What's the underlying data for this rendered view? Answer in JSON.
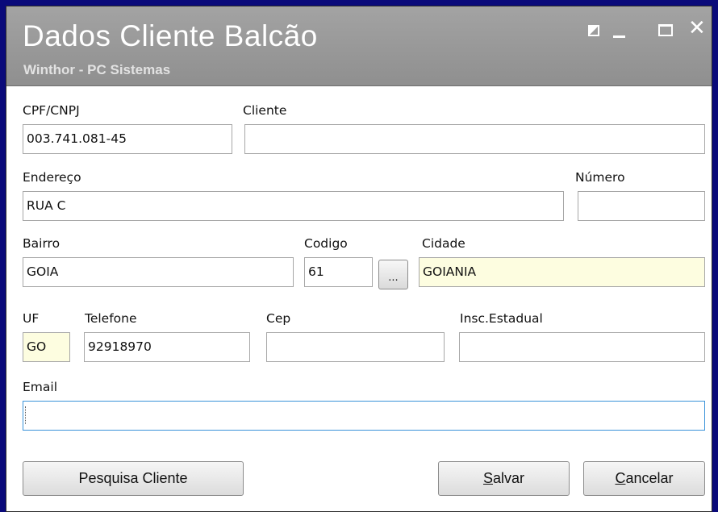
{
  "window": {
    "title": "Dados Cliente Balcão",
    "subtitle": "Winthor - PC Sistemas",
    "controls": {
      "close_glyph": "✕"
    }
  },
  "form": {
    "cpf": {
      "label": "CPF/CNPJ",
      "value": "003.741.081-45"
    },
    "cliente": {
      "label": "Cliente",
      "value": ""
    },
    "endereco": {
      "label": "Endereço",
      "value": "RUA C"
    },
    "numero": {
      "label": "Número",
      "value": ""
    },
    "bairro": {
      "label": "Bairro",
      "value": "GOIA"
    },
    "codigo": {
      "label": "Codigo",
      "value": "61",
      "lookup_label": "..."
    },
    "cidade": {
      "label": "Cidade",
      "value": "GOIANIA"
    },
    "uf": {
      "label": "UF",
      "value": "GO"
    },
    "telefone": {
      "label": "Telefone",
      "value": "92918970"
    },
    "cep": {
      "label": "Cep",
      "value": ""
    },
    "insc_estadual": {
      "label": "Insc.Estadual",
      "value": ""
    },
    "email": {
      "label": "Email",
      "value": ""
    }
  },
  "buttons": {
    "pesquisa": "Pesquisa Cliente",
    "salvar_hotkey": "S",
    "salvar_rest": "alvar",
    "cancelar_hotkey": "C",
    "cancelar_rest": "ancelar"
  },
  "colors": {
    "titlebar": "#999999",
    "readonly_field": "#fdfde0",
    "focus_border": "#3a93d9",
    "outer_frame": "#0a0a7a"
  }
}
